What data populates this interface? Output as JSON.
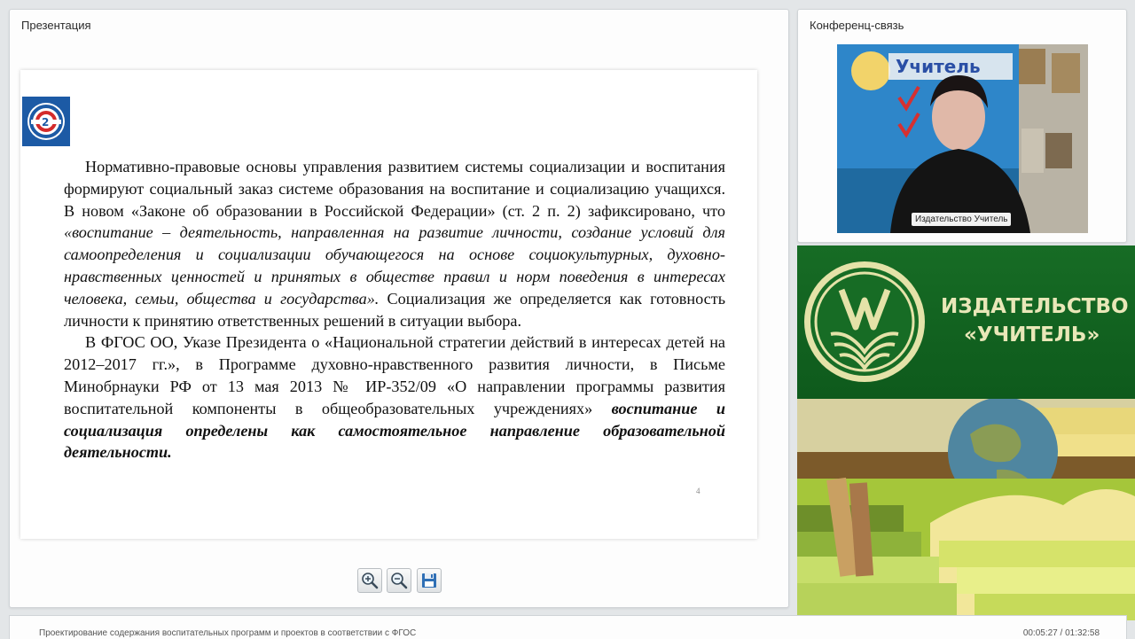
{
  "presentation": {
    "panel_title": "Презентация",
    "slide": {
      "page_number": "4",
      "paragraph1": {
        "normal1": "Нормативно-правовые основы управления развитием системы социализации и воспитания формируют социальный заказ системе образования на воспитание и социализацию учащихся. В новом «Законе об образовании в Российской Федерации» (ст. 2 п. 2) зафиксировано, что ",
        "italic": "«воспитание – деятельность, направленная на развитие личности, создание условий для самоопределения и социализации обучающегося на основе социокультурных, духовно-нравственных ценностей и принятых в обществе правил и норм поведения в интересах человека, семьи, общества и государства».",
        "normal2": " Социализация же определяется как готовность личности к принятию ответственных решений в ситуации выбора."
      },
      "paragraph2": {
        "normal": "В ФГОС ОО, Указе Президента о «Национальной стратегии действий в интересах детей на 2012–2017 гг.», в Программе духовно-нравственного развития личности, в Письме Минобрнауки РФ от 13 мая 2013 № ИР-352/09 «О направлении программы развития воспитательной компоненты в общеобразовательных учреждениях» ",
        "bold_italic": "воспитание и социализация определены как самостоятельное направление образовательной деятельности."
      }
    },
    "toolbar": {
      "zoom_in_icon": "zoom-in-icon",
      "zoom_out_icon": "zoom-out-icon",
      "save_icon": "floppy-disk-icon"
    }
  },
  "conference": {
    "panel_title": "Конференц-связь",
    "video_label": "Издательство Учитель"
  },
  "ad": {
    "title_line1": "ИЗДАТЕЛЬСТВО",
    "title_line2": "«УЧИТЕЛЬ»"
  },
  "status": {
    "course_title": "Проектирование содержания воспитательных программ и проектов в соответствии с ФГОС",
    "timer": "00:05:27 / 01:32:58"
  }
}
